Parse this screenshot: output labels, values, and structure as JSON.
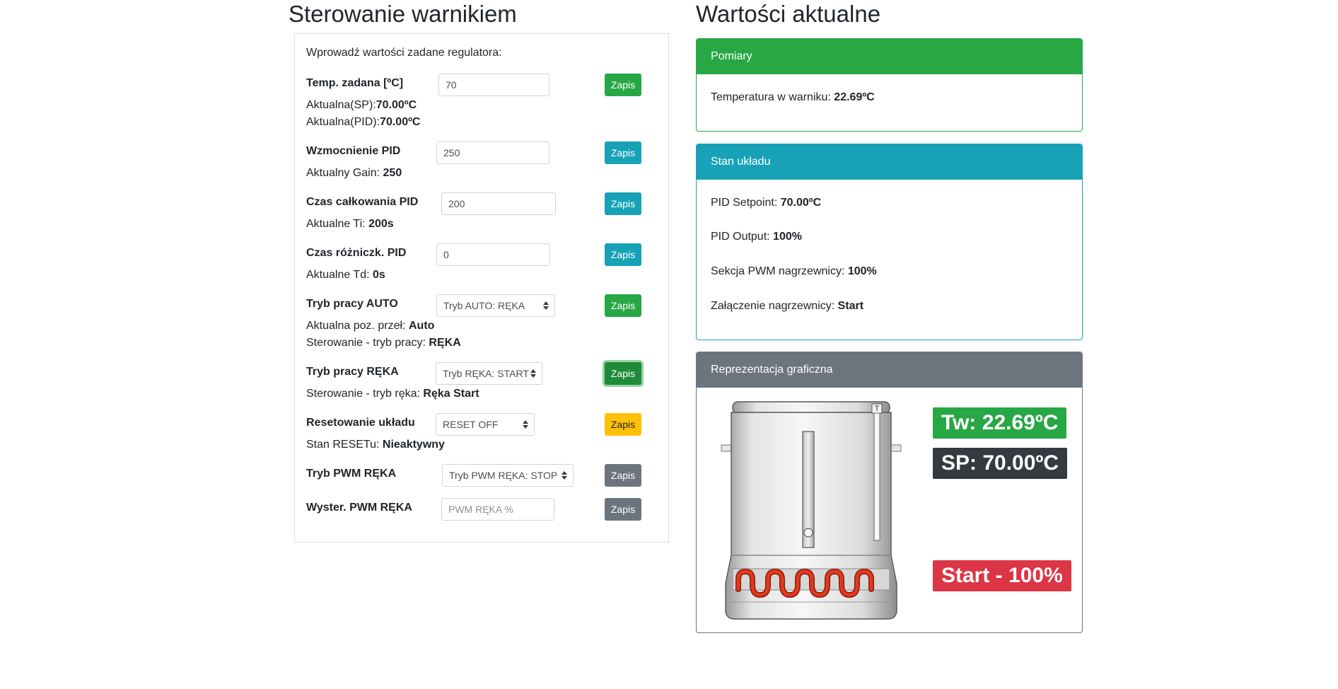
{
  "left": {
    "heading": "Sterowanie warnikiem",
    "intro": "Wprowadź wartości zadane regulatora:",
    "rows": {
      "temp": {
        "label": "Temp. zadana [ºC]",
        "value": "70",
        "button": "Zapis",
        "info1_prefix": "Aktualna(SP):",
        "info1_value": "70.00ºC",
        "info2_prefix": "Aktualna(PID):",
        "info2_value": "70.00ºC"
      },
      "gain": {
        "label": "Wzmocnienie PID",
        "value": "250",
        "button": "Zapis",
        "info_prefix": "Aktualny Gain:",
        "info_value": "250"
      },
      "ti": {
        "label": "Czas całkowania PID",
        "value": "200",
        "button": "Zapis",
        "info_prefix": "Aktualne Ti:",
        "info_value": "200s"
      },
      "td": {
        "label": "Czas różniczk. PID",
        "value": "0",
        "button": "Zapis",
        "info_prefix": "Aktualne Td:",
        "info_value": "0s"
      },
      "auto": {
        "label": "Tryb pracy AUTO",
        "select": "Tryb AUTO: RĘKA",
        "button": "Zapis",
        "info1_prefix": "Aktualna poz. przeł:",
        "info1_value": "Auto",
        "info2_prefix": "Sterowanie - tryb pracy:",
        "info2_value": "RĘKA"
      },
      "manual": {
        "label": "Tryb pracy RĘKA",
        "select": "Tryb RĘKA: START",
        "button": "Zapis",
        "info_prefix": "Sterowanie - tryb ręka:",
        "info_value": "Ręka Start"
      },
      "reset": {
        "label": "Resetowanie układu",
        "select": "RESET OFF",
        "button": "Zapis",
        "info_prefix": "Stan RESETu:",
        "info_value": "Nieaktywny"
      },
      "pwm_mode": {
        "label": "Tryb PWM RĘKA",
        "select": "Tryb PWM RĘKA: STOP",
        "button": "Zapis"
      },
      "pwm_out": {
        "label": "Wyster. PWM RĘKA",
        "placeholder": "PWM RĘKA %",
        "button": "Zapis"
      }
    }
  },
  "right": {
    "heading": "Wartości aktualne",
    "measure": {
      "title": "Pomiary",
      "line_prefix": "Temperatura w warniku:",
      "line_value": "22.69ºC"
    },
    "state": {
      "title": "Stan układu",
      "setpoint_prefix": "PID Setpoint:",
      "setpoint_value": "70.00ºC",
      "output_prefix": "PID Output:",
      "output_value": "100%",
      "pwm_prefix": "Sekcja PWM nagrzewnicy:",
      "pwm_value": "100%",
      "on_prefix": "Załączenie nagrzewnicy:",
      "on_value": "Start"
    },
    "graphic": {
      "title": "Reprezentacja graficzna",
      "thermometer_letter": "T",
      "badge_tw": "Tw: 22.69ºC",
      "badge_sp": "SP: 70.00ºC",
      "badge_start": "Start - 100%"
    }
  },
  "colors": {
    "success": "#28a745",
    "info": "#17a2b8",
    "warning": "#ffc107",
    "secondary": "#6c757d",
    "dark": "#343a40",
    "danger": "#dc3545",
    "coil": "#e03a1e"
  },
  "icons": {
    "select_caret": "chevron-up-down-icon",
    "heater_graphic": "water-heater-icon"
  }
}
